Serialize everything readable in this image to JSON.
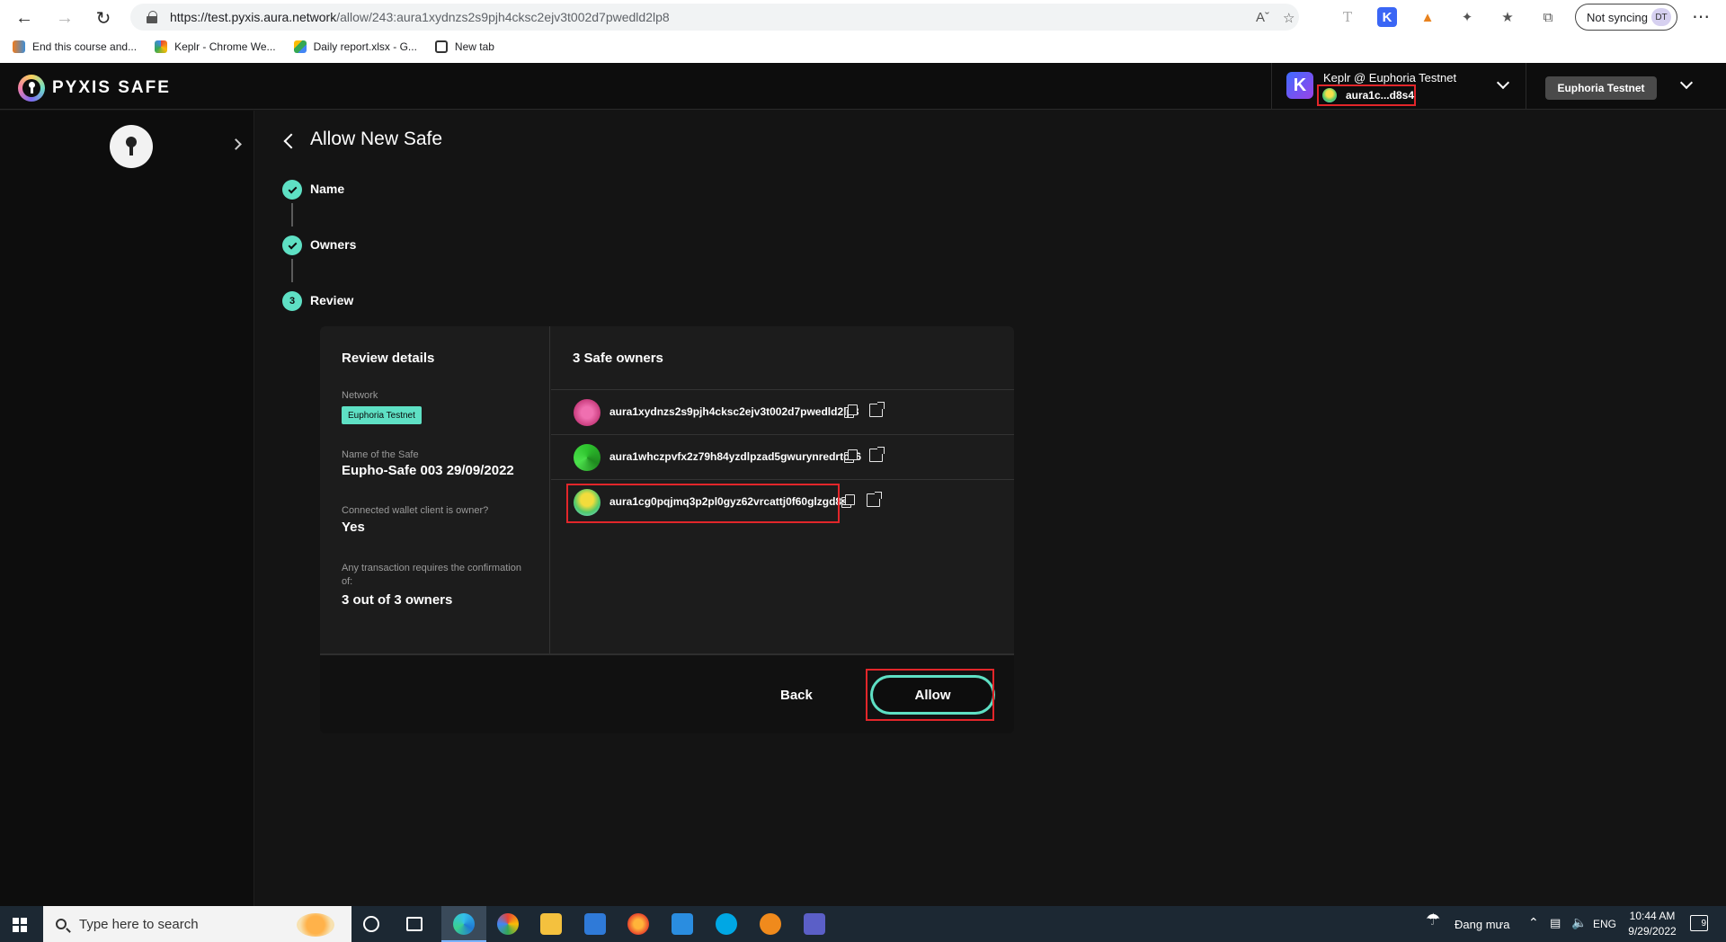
{
  "browser": {
    "url_host": "https://test.pyxis.aura.network",
    "url_path": "/allow/243:aura1xydnzs2s9pjh4cksc2ejv3t002d7pwedld2lp8",
    "sync_label": "Not syncing",
    "profile_initials": "DT",
    "bookmarks": [
      {
        "label": "End this course and..."
      },
      {
        "label": "Keplr - Chrome We..."
      },
      {
        "label": "Daily report.xlsx - G..."
      },
      {
        "label": "New tab"
      }
    ]
  },
  "app": {
    "logo_text": "PYXIS SAFE",
    "wallet": {
      "name": "Keplr @ Euphoria Testnet",
      "address": "aura1c...d8s4",
      "icon_letter": "K"
    },
    "network": "Euphoria Testnet"
  },
  "page": {
    "title": "Allow New Safe",
    "steps": [
      {
        "label": "Name",
        "state": "done"
      },
      {
        "label": "Owners",
        "state": "done"
      },
      {
        "label": "Review",
        "state": "current",
        "number": "3"
      }
    ]
  },
  "review": {
    "details_title": "Review details",
    "network_label": "Network",
    "network_value": "Euphoria Testnet",
    "safe_name_label": "Name of the Safe",
    "safe_name_value": "Eupho-Safe 003 29/09/2022",
    "owner_q_label": "Connected wallet client is owner?",
    "owner_q_value": "Yes",
    "threshold_label": "Any transaction requires the confirmation of:",
    "threshold_value": "3 out of 3 owners",
    "owners_title": "3 Safe owners",
    "owners": [
      {
        "address": "aura1xydnzs2s9pjh4cksc2ejv3t002d7pwedld2lp8",
        "color": "#d9468a"
      },
      {
        "address": "aura1whczpvfx2z79h84yzdlpzad5gwurynredrtcx6",
        "color": "#3fd13f"
      },
      {
        "address": "aura1cg0pqjmq3p2pl0gyz62vrcattj0f60glzgd8s4",
        "color": "#f2dc3c"
      }
    ],
    "back_label": "Back",
    "allow_label": "Allow"
  },
  "taskbar": {
    "search_placeholder": "Type here to search",
    "weather": "Đang mưa",
    "lang": "ENG",
    "time": "10:44 AM",
    "date": "9/29/2022",
    "notif_count": "9"
  }
}
